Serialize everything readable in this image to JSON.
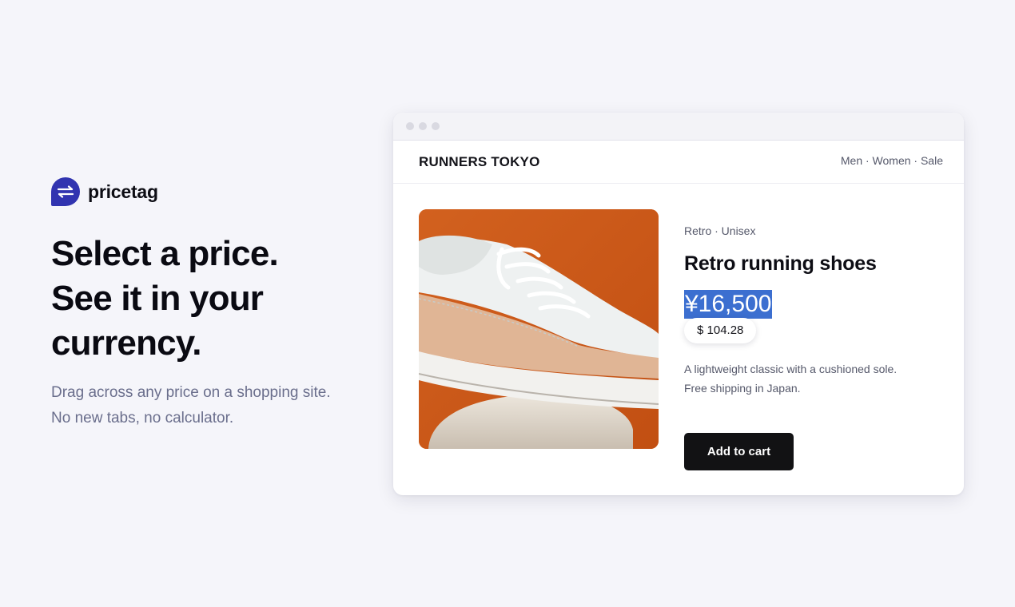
{
  "brand": {
    "name": "pricetag",
    "logo_icon": "swap-arrows-icon",
    "logo_color": "#3134b0"
  },
  "hero": {
    "headline_lines": [
      "Select a price.",
      "See it in your",
      "currency."
    ],
    "subtext_lines": [
      "Drag across any price on a shopping site.",
      "No new tabs, no calculator."
    ]
  },
  "browser": {
    "window_controls": [
      "dot",
      "dot",
      "dot"
    ],
    "site": {
      "logo": "RUNNERS TOKYO",
      "nav": "Men · Women · Sale"
    },
    "product": {
      "image": "white-and-tan-sneaker-photo",
      "category": "Retro · Unisex",
      "title": "Retro running shoes",
      "price": "¥16,500",
      "price_selected": true,
      "converted_price": "$ 104.28",
      "description_lines": [
        "A lightweight classic with a cushioned sole.",
        "Free shipping in Japan."
      ],
      "cart_label": "Add to cart"
    }
  },
  "colors": {
    "background": "#f5f5fa",
    "selection": "#3c6fd0",
    "button": "#121214",
    "photo_background": "#cd5a1c"
  }
}
